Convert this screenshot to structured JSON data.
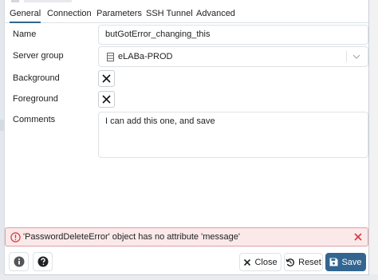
{
  "tabs": [
    {
      "label": "General",
      "active": true
    },
    {
      "label": "Connection",
      "active": false
    },
    {
      "label": "Parameters",
      "active": false
    },
    {
      "label": "SSH Tunnel",
      "active": false
    },
    {
      "label": "Advanced",
      "active": false
    }
  ],
  "form": {
    "name_label": "Name",
    "name_value": "butGotError_changing_this",
    "server_group_label": "Server group",
    "server_group_value": "eLABa-PROD",
    "background_label": "Background",
    "foreground_label": "Foreground",
    "comments_label": "Comments",
    "comments_value": "I can add this one, and save"
  },
  "error": {
    "message": "'PasswordDeleteError' object has no attribute 'message'"
  },
  "footer": {
    "info_icon": "info-icon",
    "help_icon": "help-icon",
    "close_label": "Close",
    "reset_label": "Reset",
    "save_label": "Save"
  },
  "colors": {
    "accent": "#326690",
    "error_bg": "#fbe9ea",
    "error_border": "#df9ea3",
    "error_icon": "#d9363e"
  }
}
